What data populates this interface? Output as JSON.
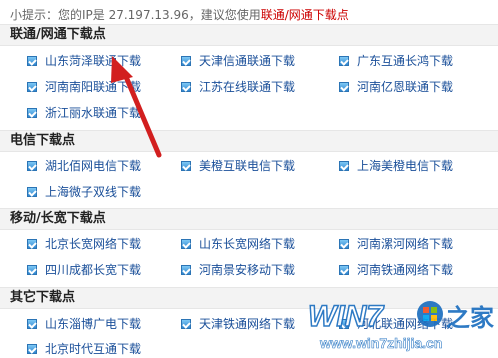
{
  "hint": {
    "prefix": "小提示：您的IP是 27.197.13.96，建议您使用",
    "recommend": "联通/网通下载点"
  },
  "sections": [
    {
      "title": "联通/网通下载点",
      "items": [
        "山东菏泽联通下载",
        "天津信通联通下载",
        "广东互通长鸿下载",
        "河南南阳联通下载",
        "江苏在线联通下载",
        "河南亿恩联通下载",
        "浙江丽水联通下载"
      ]
    },
    {
      "title": "电信下载点",
      "items": [
        "湖北佰网电信下载",
        "美橙互联电信下载",
        "上海美橙电信下载",
        "上海微子双线下载"
      ]
    },
    {
      "title": "移动/长宽下载点",
      "items": [
        "北京长宽网络下载",
        "山东长宽网络下载",
        "河南漯河网络下载",
        "四川成都长宽下载",
        "河南景安移动下载",
        "河南铁通网络下载"
      ]
    },
    {
      "title": "其它下载点",
      "items": [
        "山东淄博广电下载",
        "天津铁通网络下载",
        "河北联通网络下载",
        "北京时代互通下载"
      ]
    }
  ],
  "watermark": {
    "brand": "WIN7",
    "cn": "之家",
    "url": "www.win7zhijia.cn"
  },
  "colors": {
    "link": "#1a4f99",
    "accent_red": "#cc0000",
    "section_bg": "#f3f3f3",
    "arrow": "#d21f1f"
  }
}
